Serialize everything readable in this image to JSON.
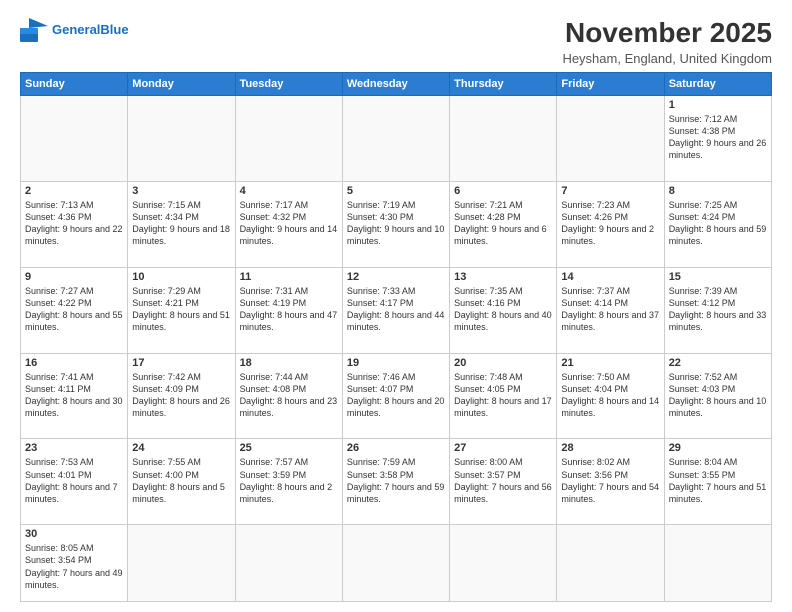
{
  "header": {
    "logo_line1": "General",
    "logo_line2": "Blue",
    "title": "November 2025",
    "subtitle": "Heysham, England, United Kingdom"
  },
  "days_of_week": [
    "Sunday",
    "Monday",
    "Tuesday",
    "Wednesday",
    "Thursday",
    "Friday",
    "Saturday"
  ],
  "weeks": [
    [
      {
        "day": "",
        "info": ""
      },
      {
        "day": "",
        "info": ""
      },
      {
        "day": "",
        "info": ""
      },
      {
        "day": "",
        "info": ""
      },
      {
        "day": "",
        "info": ""
      },
      {
        "day": "",
        "info": ""
      },
      {
        "day": "1",
        "info": "Sunrise: 7:12 AM\nSunset: 4:38 PM\nDaylight: 9 hours\nand 26 minutes."
      }
    ],
    [
      {
        "day": "2",
        "info": "Sunrise: 7:13 AM\nSunset: 4:36 PM\nDaylight: 9 hours\nand 22 minutes."
      },
      {
        "day": "3",
        "info": "Sunrise: 7:15 AM\nSunset: 4:34 PM\nDaylight: 9 hours\nand 18 minutes."
      },
      {
        "day": "4",
        "info": "Sunrise: 7:17 AM\nSunset: 4:32 PM\nDaylight: 9 hours\nand 14 minutes."
      },
      {
        "day": "5",
        "info": "Sunrise: 7:19 AM\nSunset: 4:30 PM\nDaylight: 9 hours\nand 10 minutes."
      },
      {
        "day": "6",
        "info": "Sunrise: 7:21 AM\nSunset: 4:28 PM\nDaylight: 9 hours\nand 6 minutes."
      },
      {
        "day": "7",
        "info": "Sunrise: 7:23 AM\nSunset: 4:26 PM\nDaylight: 9 hours\nand 2 minutes."
      },
      {
        "day": "8",
        "info": "Sunrise: 7:25 AM\nSunset: 4:24 PM\nDaylight: 8 hours\nand 59 minutes."
      }
    ],
    [
      {
        "day": "9",
        "info": "Sunrise: 7:27 AM\nSunset: 4:22 PM\nDaylight: 8 hours\nand 55 minutes."
      },
      {
        "day": "10",
        "info": "Sunrise: 7:29 AM\nSunset: 4:21 PM\nDaylight: 8 hours\nand 51 minutes."
      },
      {
        "day": "11",
        "info": "Sunrise: 7:31 AM\nSunset: 4:19 PM\nDaylight: 8 hours\nand 47 minutes."
      },
      {
        "day": "12",
        "info": "Sunrise: 7:33 AM\nSunset: 4:17 PM\nDaylight: 8 hours\nand 44 minutes."
      },
      {
        "day": "13",
        "info": "Sunrise: 7:35 AM\nSunset: 4:16 PM\nDaylight: 8 hours\nand 40 minutes."
      },
      {
        "day": "14",
        "info": "Sunrise: 7:37 AM\nSunset: 4:14 PM\nDaylight: 8 hours\nand 37 minutes."
      },
      {
        "day": "15",
        "info": "Sunrise: 7:39 AM\nSunset: 4:12 PM\nDaylight: 8 hours\nand 33 minutes."
      }
    ],
    [
      {
        "day": "16",
        "info": "Sunrise: 7:41 AM\nSunset: 4:11 PM\nDaylight: 8 hours\nand 30 minutes."
      },
      {
        "day": "17",
        "info": "Sunrise: 7:42 AM\nSunset: 4:09 PM\nDaylight: 8 hours\nand 26 minutes."
      },
      {
        "day": "18",
        "info": "Sunrise: 7:44 AM\nSunset: 4:08 PM\nDaylight: 8 hours\nand 23 minutes."
      },
      {
        "day": "19",
        "info": "Sunrise: 7:46 AM\nSunset: 4:07 PM\nDaylight: 8 hours\nand 20 minutes."
      },
      {
        "day": "20",
        "info": "Sunrise: 7:48 AM\nSunset: 4:05 PM\nDaylight: 8 hours\nand 17 minutes."
      },
      {
        "day": "21",
        "info": "Sunrise: 7:50 AM\nSunset: 4:04 PM\nDaylight: 8 hours\nand 14 minutes."
      },
      {
        "day": "22",
        "info": "Sunrise: 7:52 AM\nSunset: 4:03 PM\nDaylight: 8 hours\nand 10 minutes."
      }
    ],
    [
      {
        "day": "23",
        "info": "Sunrise: 7:53 AM\nSunset: 4:01 PM\nDaylight: 8 hours\nand 7 minutes."
      },
      {
        "day": "24",
        "info": "Sunrise: 7:55 AM\nSunset: 4:00 PM\nDaylight: 8 hours\nand 5 minutes."
      },
      {
        "day": "25",
        "info": "Sunrise: 7:57 AM\nSunset: 3:59 PM\nDaylight: 8 hours\nand 2 minutes."
      },
      {
        "day": "26",
        "info": "Sunrise: 7:59 AM\nSunset: 3:58 PM\nDaylight: 7 hours\nand 59 minutes."
      },
      {
        "day": "27",
        "info": "Sunrise: 8:00 AM\nSunset: 3:57 PM\nDaylight: 7 hours\nand 56 minutes."
      },
      {
        "day": "28",
        "info": "Sunrise: 8:02 AM\nSunset: 3:56 PM\nDaylight: 7 hours\nand 54 minutes."
      },
      {
        "day": "29",
        "info": "Sunrise: 8:04 AM\nSunset: 3:55 PM\nDaylight: 7 hours\nand 51 minutes."
      }
    ],
    [
      {
        "day": "30",
        "info": "Sunrise: 8:05 AM\nSunset: 3:54 PM\nDaylight: 7 hours\nand 49 minutes."
      },
      {
        "day": "",
        "info": ""
      },
      {
        "day": "",
        "info": ""
      },
      {
        "day": "",
        "info": ""
      },
      {
        "day": "",
        "info": ""
      },
      {
        "day": "",
        "info": ""
      },
      {
        "day": "",
        "info": ""
      }
    ]
  ]
}
